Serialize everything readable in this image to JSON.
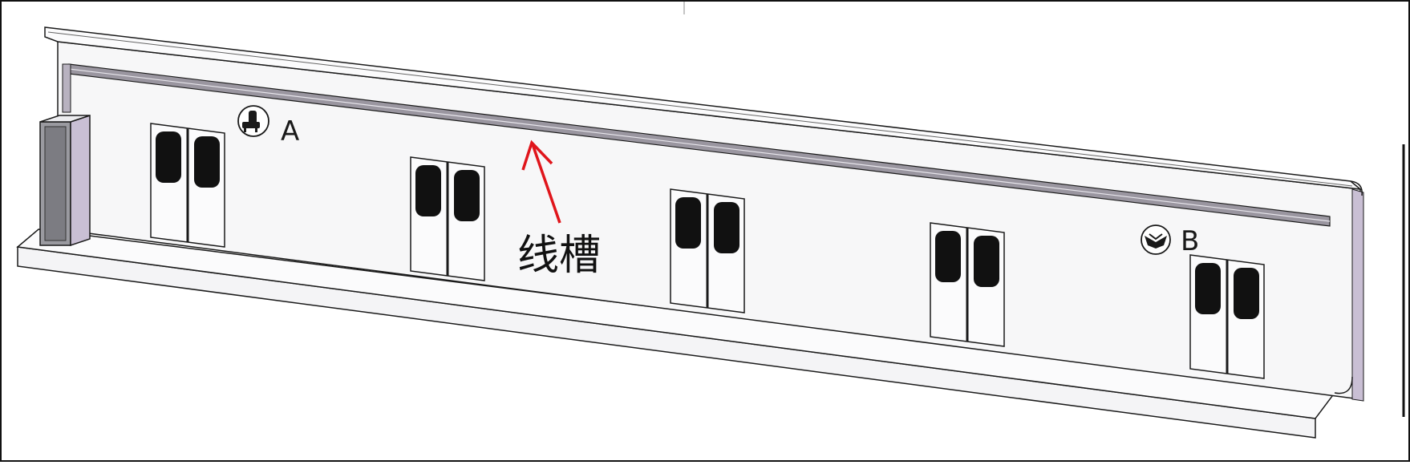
{
  "diagram": {
    "callout_label": "线槽",
    "marker_a_label": "A",
    "marker_b_label": "B",
    "colors": {
      "outline": "#1a1a1a",
      "wall_fill": "#f7f7f8",
      "shadow": "#c9bfd4",
      "window": "#111111",
      "arrow": "#e0151b"
    },
    "marker_a_icon": "seat-icon",
    "marker_b_icon": "wing-icon"
  }
}
